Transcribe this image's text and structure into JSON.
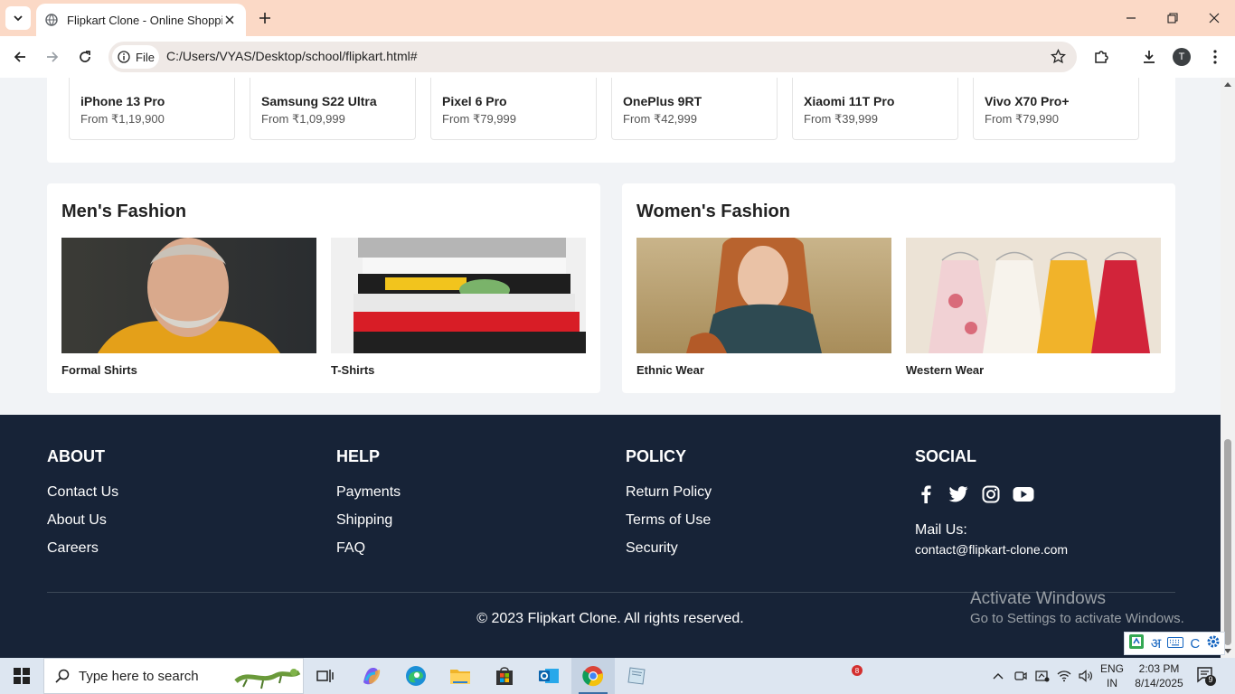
{
  "browser": {
    "tab_title": "Flipkart Clone - Online Shopping",
    "scheme_label": "File",
    "url": "C:/Users/VYAS/Desktop/school/flipkart.html#",
    "profile_initial": "T"
  },
  "products": [
    {
      "name": "iPhone 13 Pro",
      "price": "From ₹1,19,900"
    },
    {
      "name": "Samsung S22 Ultra",
      "price": "From ₹1,09,999"
    },
    {
      "name": "Pixel 6 Pro",
      "price": "From ₹79,999"
    },
    {
      "name": "OnePlus 9RT",
      "price": "From ₹42,999"
    },
    {
      "name": "Xiaomi 11T Pro",
      "price": "From ₹39,999"
    },
    {
      "name": "Vivo X70 Pro+",
      "price": "From ₹79,990"
    }
  ],
  "mens_fashion": {
    "title": "Men's Fashion",
    "items": [
      {
        "label": "Formal Shirts"
      },
      {
        "label": "T-Shirts"
      }
    ]
  },
  "womens_fashion": {
    "title": "Women's Fashion",
    "items": [
      {
        "label": "Ethnic Wear"
      },
      {
        "label": "Western Wear"
      }
    ]
  },
  "footer": {
    "about": {
      "title": "ABOUT",
      "links": [
        "Contact Us",
        "About Us",
        "Careers"
      ]
    },
    "help": {
      "title": "HELP",
      "links": [
        "Payments",
        "Shipping",
        "FAQ"
      ]
    },
    "policy": {
      "title": "POLICY",
      "links": [
        "Return Policy",
        "Terms of Use",
        "Security"
      ]
    },
    "social": {
      "title": "SOCIAL",
      "icons": [
        "facebook-icon",
        "twitter-icon",
        "instagram-icon",
        "youtube-icon"
      ],
      "mail_label": "Mail Us:",
      "mail_address": "contact@flipkart-clone.com"
    },
    "copyright": "© 2023 Flipkart Clone. All rights reserved.",
    "background": "#172337"
  },
  "watermark": {
    "line1": "Activate Windows",
    "line2": "Go to Settings to activate Windows."
  },
  "ime_toolbar": {
    "hindi_glyph": "अ",
    "c_label": "C"
  },
  "taskbar": {
    "search_placeholder": "Type here to search",
    "badge_count": "8",
    "lang_line1": "ENG",
    "lang_line2": "IN",
    "time": "2:03 PM",
    "date": "8/14/2025",
    "notification_count": "9"
  }
}
